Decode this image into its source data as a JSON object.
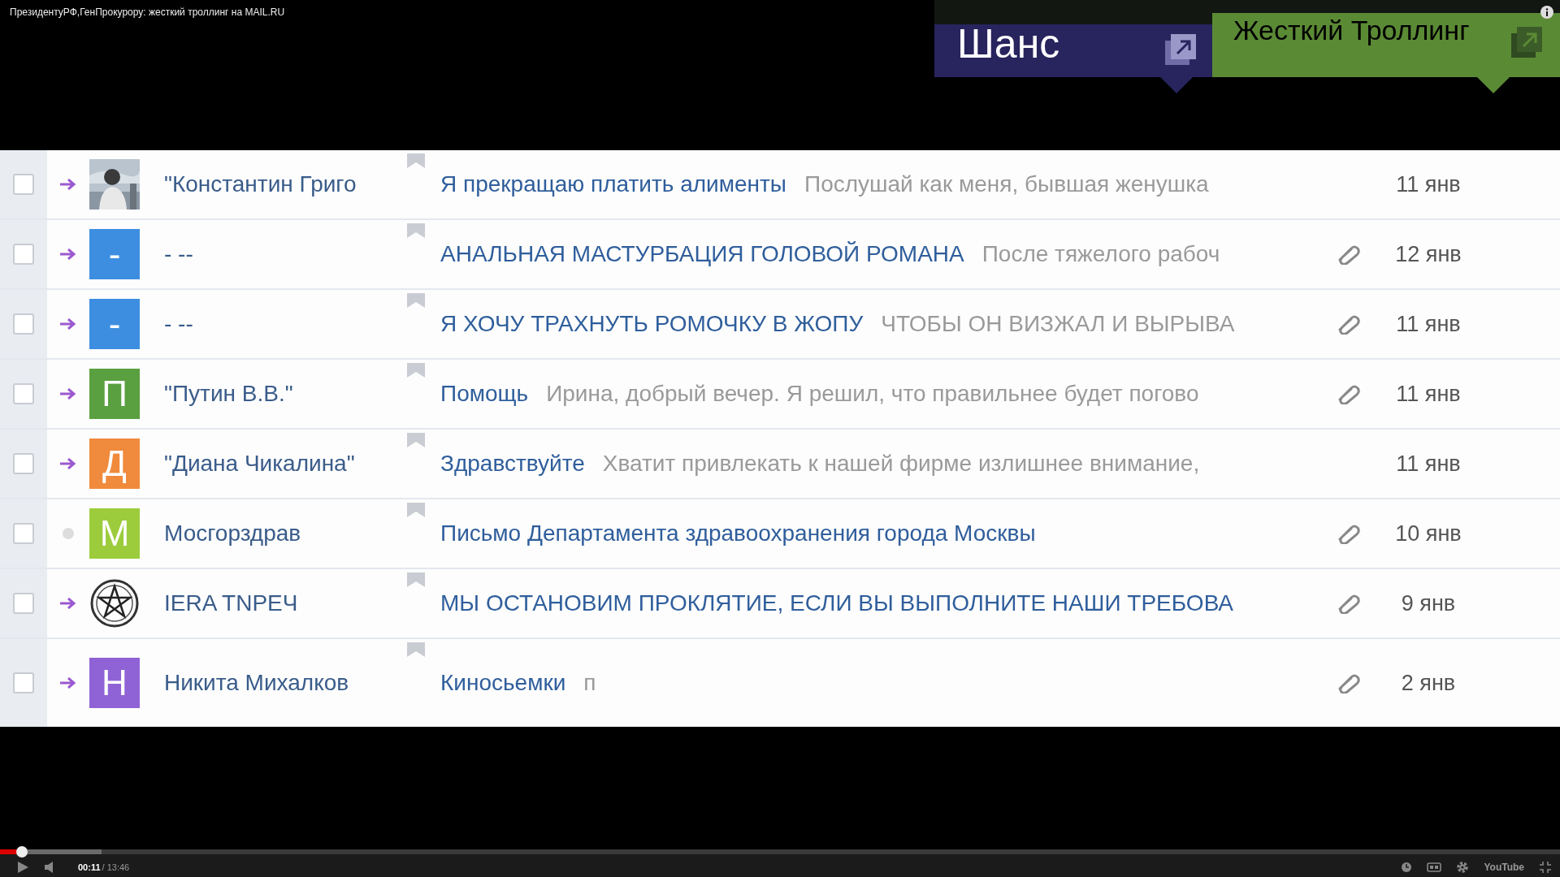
{
  "video_title": "ПрезидентуРФ,ГенПрокурору: жесткий троллинг на MAIL.RU",
  "annotations": [
    {
      "label": "Шанс",
      "color": "#27245e"
    },
    {
      "label": "Жесткий Троллинг",
      "color": "#5b8a35"
    }
  ],
  "mail_rows": [
    {
      "checked": false,
      "replied": true,
      "sender": "\"Константин Григо",
      "subject": "Я прекращаю платить алименты",
      "preview": "Послушай как меня, бывшая женушка",
      "attachment": false,
      "date": "11 янв"
    },
    {
      "checked": false,
      "replied": true,
      "avatar": {
        "kind": "letter",
        "letter": "-",
        "color": "#3d8ee0"
      },
      "sender": "- --",
      "subject": "АНАЛЬНАЯ МАСТУРБАЦИЯ ГОЛОВОЙ РОМАНА",
      "preview": "После тяжелого рабоч",
      "attachment": true,
      "date": "12 янв"
    },
    {
      "checked": false,
      "replied": true,
      "avatar": {
        "kind": "letter",
        "letter": "-",
        "color": "#3d8ee0"
      },
      "sender": "- --",
      "subject": "Я ХОЧУ ТРАХНУТЬ РОМОЧКУ В ЖОПУ",
      "preview": "ЧТОБЫ ОН ВИЗЖАЛ И ВЫРЫВА",
      "attachment": true,
      "date": "11 янв"
    },
    {
      "checked": false,
      "replied": true,
      "avatar": {
        "kind": "letter",
        "letter": "П",
        "color": "#5aa040"
      },
      "sender": "\"Путин В.В.\"",
      "subject": "Помощь",
      "preview": "Ирина, добрый вечер. Я решил, что правильнее будет погово",
      "attachment": true,
      "date": "11 янв"
    },
    {
      "checked": false,
      "replied": true,
      "avatar": {
        "kind": "letter",
        "letter": "Д",
        "color": "#f08a3c"
      },
      "sender": "\"Диана Чикалина\"",
      "subject": "Здравствуйте",
      "preview": "Хватит привлекать к нашей фирме излишнее внимание,",
      "attachment": false,
      "date": "11 янв"
    },
    {
      "checked": false,
      "replied": false,
      "avatar": {
        "kind": "letter",
        "letter": "М",
        "color": "#9ccc3c"
      },
      "sender": "Мосгорздрав",
      "subject": "Письмо Департамента здравоохранения города Москвы",
      "attachment": true,
      "date": "10 янв"
    },
    {
      "checked": false,
      "replied": true,
      "avatar": {
        "kind": "emblem"
      },
      "sender": "IERA TNPEЧ",
      "subject": "МЫ ОСТАНОВИМ ПРОКЛЯТИЕ, ЕСЛИ ВЫ ВЫПОЛНИТЕ НАШИ ТРЕБОВА",
      "attachment": true,
      "date": "9 янв"
    },
    {
      "checked": false,
      "replied": true,
      "avatar": {
        "kind": "letter",
        "letter": "Н",
        "color": "#8f63d6"
      },
      "sender": "Никита Михалков",
      "subject": "Киносьемки",
      "preview": "п",
      "attachment": true,
      "date": "2 янв"
    }
  ],
  "player": {
    "progress": {
      "level": 0.014
    },
    "current_time": "00:11",
    "duration": "/ 13:46",
    "logo": "YouTube"
  }
}
